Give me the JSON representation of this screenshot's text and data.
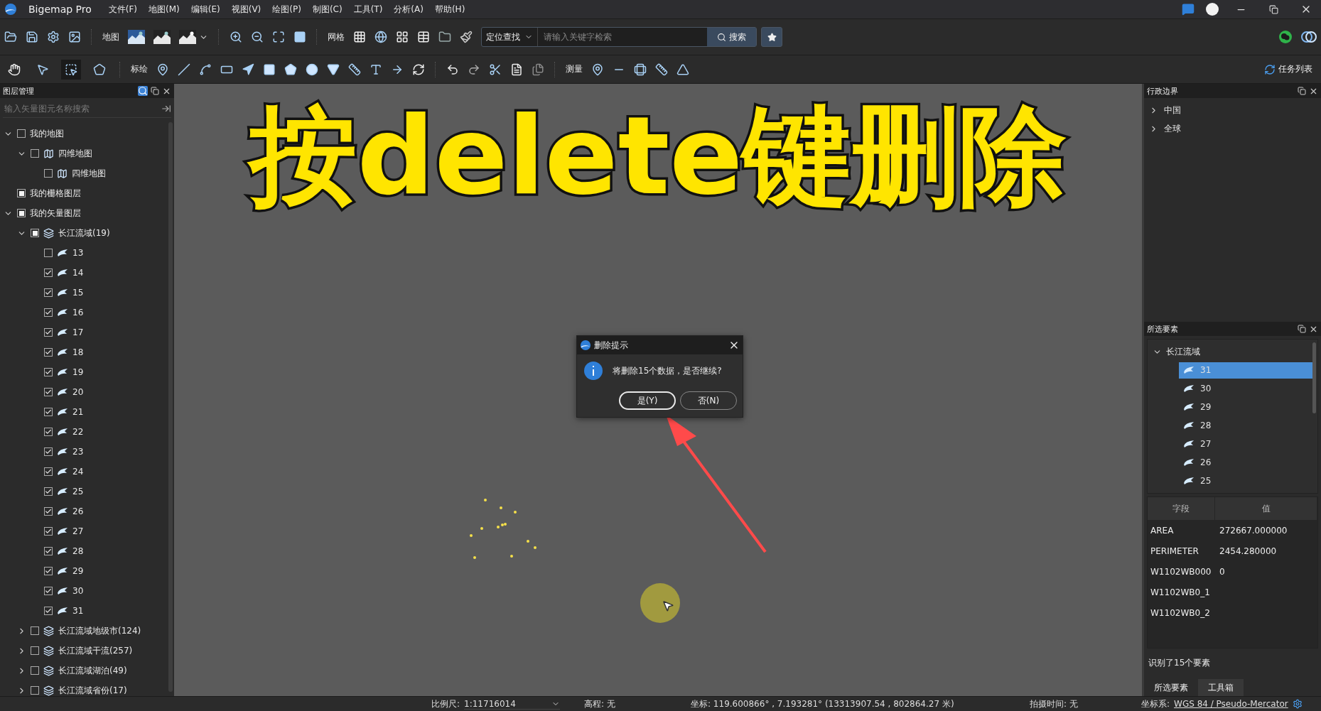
{
  "window": {
    "title": "Bigemap Pro"
  },
  "menu": [
    "文件(F)",
    "地图(M)",
    "编辑(E)",
    "视图(V)",
    "绘图(P)",
    "制图(C)",
    "工具(T)",
    "分析(A)",
    "帮助(H)"
  ],
  "toolbar": {
    "map_label": "地图",
    "grid_label": "网格",
    "search": {
      "scope": "定位查找",
      "placeholder": "请输入关键字检索",
      "button": "搜索"
    }
  },
  "toolbar2": {
    "edit_tools": [
      {
        "kind": "hand",
        "selected": false
      },
      {
        "kind": "pointer",
        "selected": false
      },
      {
        "kind": "select-box",
        "selected": true
      },
      {
        "kind": "edit-shape",
        "selected": false
      }
    ],
    "plot_label": "标绘",
    "measure_label": "测量",
    "tasks": "任务列表"
  },
  "layer_panel": {
    "title": "图层管理",
    "search_placeholder": "输入矢量图元名称搜索",
    "tree": [
      {
        "label": "我的地图",
        "checked": false,
        "partial": false,
        "expanded": true,
        "children": [
          {
            "label": "四维地图",
            "kind": "map",
            "checked": false,
            "partial": false,
            "expanded": true,
            "children": [
              {
                "label": "四维地图",
                "kind": "map",
                "checked": false
              }
            ]
          }
        ]
      },
      {
        "label": "我的栅格图层",
        "checked": false,
        "partial": true
      },
      {
        "label": "我的矢量图层",
        "checked": false,
        "partial": true,
        "expanded": true,
        "children": [
          {
            "label": "长江流域(19)",
            "kind": "layer",
            "checked": false,
            "partial": true,
            "expanded": true,
            "children": [
              {
                "label": "13",
                "kind": "feature",
                "checked": false
              },
              {
                "label": "14",
                "kind": "feature",
                "checked": true
              },
              {
                "label": "15",
                "kind": "feature",
                "checked": true
              },
              {
                "label": "16",
                "kind": "feature",
                "checked": true
              },
              {
                "label": "17",
                "kind": "feature",
                "checked": true
              },
              {
                "label": "18",
                "kind": "feature",
                "checked": true
              },
              {
                "label": "19",
                "kind": "feature",
                "checked": true
              },
              {
                "label": "20",
                "kind": "feature",
                "checked": true
              },
              {
                "label": "21",
                "kind": "feature",
                "checked": true
              },
              {
                "label": "22",
                "kind": "feature",
                "checked": true
              },
              {
                "label": "23",
                "kind": "feature",
                "checked": true
              },
              {
                "label": "24",
                "kind": "feature",
                "checked": true
              },
              {
                "label": "25",
                "kind": "feature",
                "checked": true
              },
              {
                "label": "26",
                "kind": "feature",
                "checked": true
              },
              {
                "label": "27",
                "kind": "feature",
                "checked": true
              },
              {
                "label": "28",
                "kind": "feature",
                "checked": true
              },
              {
                "label": "29",
                "kind": "feature",
                "checked": true
              },
              {
                "label": "30",
                "kind": "feature",
                "checked": true
              },
              {
                "label": "31",
                "kind": "feature",
                "checked": true
              }
            ]
          },
          {
            "label": "长江流域地级市(124)",
            "kind": "layer",
            "checked": false,
            "partial": false,
            "expanded": false
          },
          {
            "label": "长江流域干流(257)",
            "kind": "layer",
            "checked": false,
            "partial": false,
            "expanded": false
          },
          {
            "label": "长江流域湖泊(49)",
            "kind": "layer",
            "checked": false,
            "partial": false,
            "expanded": false
          },
          {
            "label": "长江流域省份(17)",
            "kind": "layer",
            "checked": false,
            "partial": false,
            "expanded": false
          }
        ]
      }
    ]
  },
  "caption": "按delete键删除",
  "dialog": {
    "title": "删除提示",
    "message": "将删除15个数据，是否继续?",
    "buttons": [
      {
        "label": "是(Y)",
        "selected": true
      },
      {
        "label": "否(N)",
        "selected": false
      }
    ]
  },
  "boundary_panel": {
    "title": "行政边界",
    "items": [
      {
        "label": "中国",
        "expanded": false
      },
      {
        "label": "全球",
        "expanded": false
      }
    ]
  },
  "selection_panel": {
    "title": "所选要素",
    "tree": {
      "label": "长江流域",
      "expanded": true,
      "children": [
        {
          "label": "31",
          "selected": true
        },
        {
          "label": "30",
          "selected": false
        },
        {
          "label": "29",
          "selected": false
        },
        {
          "label": "28",
          "selected": false
        },
        {
          "label": "27",
          "selected": false
        },
        {
          "label": "26",
          "selected": false
        },
        {
          "label": "25",
          "selected": false
        }
      ]
    },
    "columns": [
      "字段",
      "值"
    ],
    "rows": [
      {
        "field": "AREA",
        "value": "272667.000000"
      },
      {
        "field": "PERIMETER",
        "value": "2454.280000"
      },
      {
        "field": "W1102WB000",
        "value": "0"
      },
      {
        "field": "W1102WB0_1"
      },
      {
        "field": "W1102WB0_2"
      }
    ],
    "summary": "识别了15个要素",
    "tabs": [
      {
        "label": "所选要素",
        "selected": true
      },
      {
        "label": "工具箱",
        "selected": false
      }
    ]
  },
  "status_bar": {
    "scale_label": "比例尺:",
    "scale": "1:11716014",
    "elevation": "高程: 无",
    "coords": "坐标: 119.600866° , 7.193281°   (13313907.54 , 802864.27 米)",
    "capture_time": "拍摄时间: 无",
    "crs_label": "坐标系:",
    "crs": "WGS 84 / Pseudo-Mercator"
  }
}
